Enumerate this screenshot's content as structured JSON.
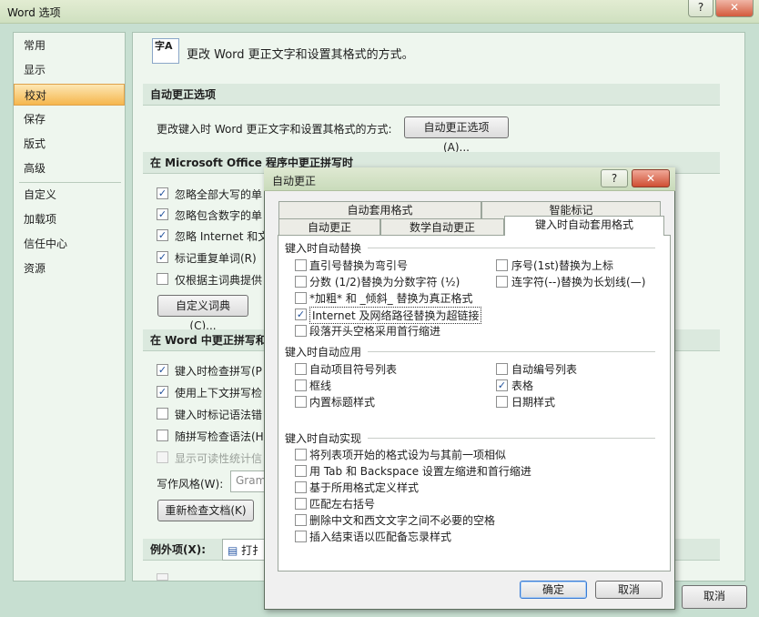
{
  "window": {
    "title": "Word 选项",
    "help_glyph": "?",
    "close_glyph": "✕"
  },
  "sidebar": {
    "items": [
      {
        "label": "常用"
      },
      {
        "label": "显示"
      },
      {
        "label": "校对"
      },
      {
        "label": "保存"
      },
      {
        "label": "版式"
      },
      {
        "label": "高级"
      },
      {
        "label": "自定义"
      },
      {
        "label": "加载项"
      },
      {
        "label": "信任中心"
      },
      {
        "label": "资源"
      }
    ],
    "selected": "校对"
  },
  "main": {
    "header": "更改 Word 更正文字和设置其格式的方式。",
    "header_icon_label": "字A",
    "autocorrect_section": {
      "title": "自动更正选项",
      "desc": "更改键入时 Word 更正文字和设置其格式的方式:",
      "button": "自动更正选项(A)..."
    },
    "office_section": {
      "title": "在 Microsoft Office 程序中更正拼写时",
      "items": [
        {
          "label": "忽略全部大写的单",
          "checked": true
        },
        {
          "label": "忽略包含数字的单",
          "checked": true
        },
        {
          "label": "忽略 Internet 和文",
          "checked": true
        },
        {
          "label": "标记重复单词(R)",
          "checked": true
        },
        {
          "label": "仅根据主词典提供",
          "checked": false
        }
      ],
      "button": "自定义词典(C)..."
    },
    "word_section": {
      "title": "在 Word 中更正拼写和",
      "items": [
        {
          "label": "键入时检查拼写(P",
          "checked": true,
          "disabled": false
        },
        {
          "label": "使用上下文拼写检",
          "checked": true,
          "disabled": false
        },
        {
          "label": "键入时标记语法错",
          "checked": false,
          "disabled": false
        },
        {
          "label": "随拼写检查语法(H",
          "checked": false,
          "disabled": false
        },
        {
          "label": "显示可读性统计信",
          "checked": false,
          "disabled": true
        }
      ],
      "style_label": "写作风格(W):",
      "style_value": "Gram",
      "recheck_button": "重新检查文档(K)"
    },
    "exceptions": {
      "label": "例外项(X):",
      "value": "打扌"
    },
    "cancel_button": "取消"
  },
  "dialog": {
    "title": "自动更正",
    "help_glyph": "?",
    "close_glyph": "✕",
    "tabs_row1": [
      {
        "label": "自动套用格式"
      },
      {
        "label": "智能标记"
      }
    ],
    "tabs_row2": [
      {
        "label": "自动更正"
      },
      {
        "label": "数学自动更正"
      },
      {
        "label": "键入时自动套用格式"
      }
    ],
    "active_tab": "键入时自动套用格式",
    "group1": {
      "title": "键入时自动替换",
      "left": [
        {
          "label": "直引号替换为弯引号",
          "checked": false
        },
        {
          "label": "分数 (1/2)替换为分数字符 (½)",
          "checked": false
        },
        {
          "label": "*加粗* 和 _倾斜_ 替换为真正格式",
          "checked": false
        },
        {
          "label": "Internet 及网络路径替换为超链接",
          "checked": true
        },
        {
          "label": "段落开头空格采用首行缩进",
          "checked": false
        }
      ],
      "right": [
        {
          "label": "序号(1st)替换为上标",
          "checked": false
        },
        {
          "label": "连字符(--)替换为长划线(—)",
          "checked": false
        }
      ]
    },
    "group2": {
      "title": "键入时自动应用",
      "left": [
        {
          "label": "自动项目符号列表",
          "checked": false
        },
        {
          "label": "框线",
          "checked": false
        },
        {
          "label": "内置标题样式",
          "checked": false
        }
      ],
      "right": [
        {
          "label": "自动编号列表",
          "checked": false
        },
        {
          "label": "表格",
          "checked": true
        },
        {
          "label": "日期样式",
          "checked": false
        }
      ]
    },
    "group3": {
      "title": "键入时自动实现",
      "items": [
        {
          "label": "将列表项开始的格式设为与其前一项相似",
          "checked": false
        },
        {
          "label": "用 Tab 和 Backspace 设置左缩进和首行缩进",
          "checked": false
        },
        {
          "label": "基于所用格式定义样式",
          "checked": false
        },
        {
          "label": "匹配左右括号",
          "checked": false
        },
        {
          "label": "删除中文和西文文字之间不必要的空格",
          "checked": false
        },
        {
          "label": "插入结束语以匹配备忘录样式",
          "checked": false
        }
      ]
    },
    "ok_button": "确定",
    "cancel_button": "取消"
  }
}
